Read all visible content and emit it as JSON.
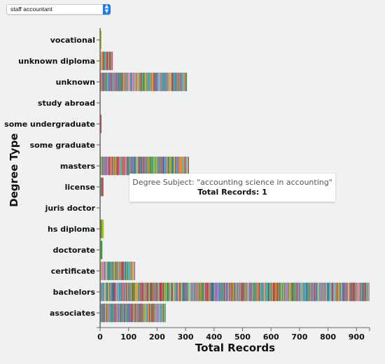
{
  "controls": {
    "select_value": "staff accountant"
  },
  "tooltip": {
    "subject_label": "Degree Subject: \"accounting science in accounting\"",
    "records_label": "Total Records: 1"
  },
  "chart_data": {
    "type": "bar",
    "orientation": "horizontal",
    "stacked": true,
    "title": "",
    "xlabel": "Total Records",
    "ylabel": "Degree Type",
    "categories": [
      "vocational",
      "unknown diploma",
      "unknown",
      "study abroad",
      "some undergraduate",
      "some graduate",
      "masters",
      "license",
      "juris doctor",
      "hs diploma",
      "doctorate",
      "certificate",
      "bachelors",
      "associates"
    ],
    "values": [
      2,
      45,
      305,
      0,
      2,
      0,
      312,
      7,
      0,
      7,
      4,
      123,
      946,
      231
    ],
    "xlim": [
      0,
      946
    ],
    "xticks": [
      0,
      100,
      200,
      300,
      400,
      500,
      600,
      700,
      800,
      900
    ],
    "grid": false,
    "legend": "none",
    "segment_palette": [
      "#1f77b4",
      "#ff7f0e",
      "#2ca02c",
      "#d62728",
      "#9467bd",
      "#8c564b",
      "#e377c2",
      "#7f7f7f",
      "#bcbd22",
      "#17becf",
      "#3b8bc2",
      "#c44e52",
      "#55a868",
      "#8172b2",
      "#ccb974",
      "#64b5cd"
    ]
  }
}
